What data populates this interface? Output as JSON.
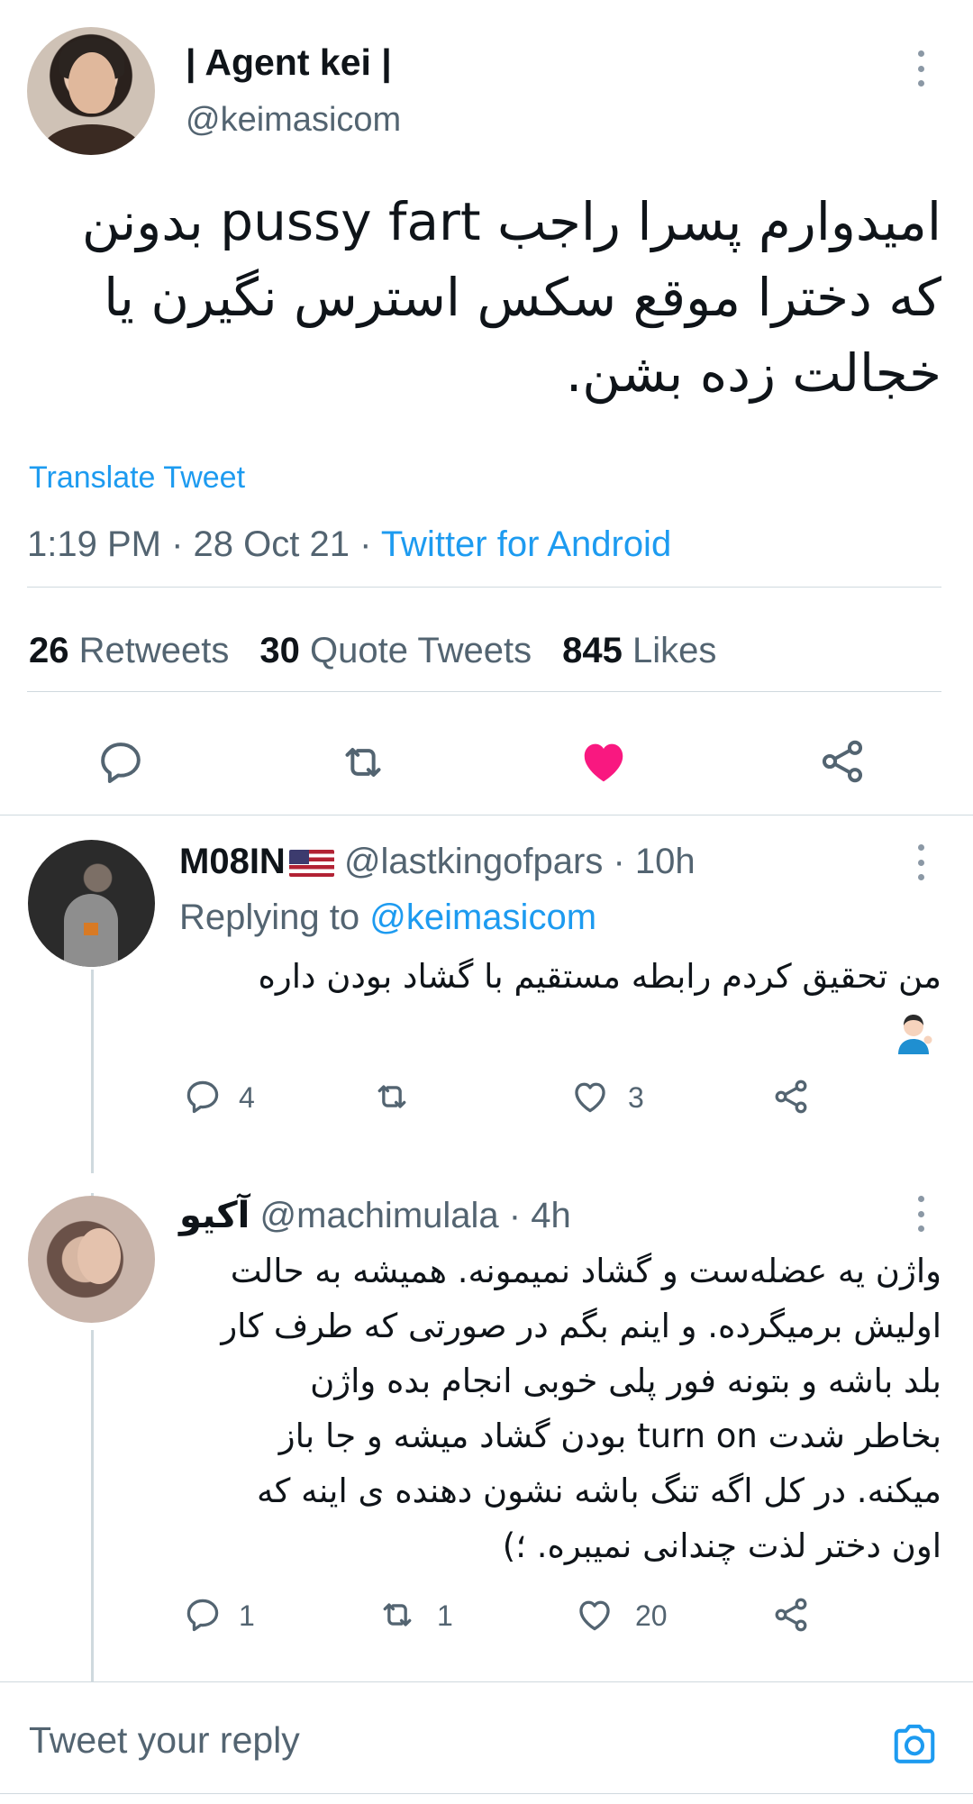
{
  "main_tweet": {
    "display_name": "| Agent kei |",
    "handle": "@keimasicom",
    "text_lines": [
      "امیدوارم پسرا راجب pussy fart بدونن",
      "که دخترا موقع سکس استرس نگیرن یا",
      "خجالت زده بشن."
    ],
    "translate_label": "Translate Tweet",
    "time": "1:19 PM",
    "date": "28 Oct 21",
    "separator": "·",
    "source": "Twitter for Android",
    "stats": {
      "retweets_count": "26",
      "retweets_label": "Retweets",
      "quotes_count": "30",
      "quotes_label": "Quote Tweets",
      "likes_count": "845",
      "likes_label": "Likes"
    },
    "liked": true
  },
  "replies": [
    {
      "display_name": "M08IN",
      "flag": "us-flag-emoji",
      "handle": "@lastkingofpars",
      "age": "10h",
      "replying_to_label": "Replying to",
      "replying_to_handle": "@keimasicom",
      "text_lines": [
        "من تحقیق کردم رابطه مستقیم با گشاد بودن داره"
      ],
      "trailing_emoji": "person-tipping-hand-emoji",
      "reply_count": "4",
      "retweet_count": "",
      "like_count": "3"
    },
    {
      "display_name": "آکیو",
      "handle": "@machimulala",
      "age": "4h",
      "text_lines": [
        "واژن یه عضله‌ست و گشاد نمیمونه. همیشه به حالت",
        "اولیش برمیگرده. و اینم بگم در صورتی که طرف کار",
        "بلد باشه و بتونه فور پلی خوبی انجام بده واژن",
        "بخاطر شدت turn on بودن گشاد میشه و جا باز",
        "میکنه. در کل اگه تنگ باشه نشون دهنده ی اینه که",
        "اون دختر لذت چندانی نمیبره. ؛)"
      ],
      "reply_count": "1",
      "retweet_count": "1",
      "like_count": "20"
    }
  ],
  "composer": {
    "placeholder": "Tweet your reply"
  },
  "colors": {
    "accent": "#1d9bf0",
    "like": "#f91880",
    "secondary_text": "#536471",
    "divider": "#cfd9de"
  }
}
